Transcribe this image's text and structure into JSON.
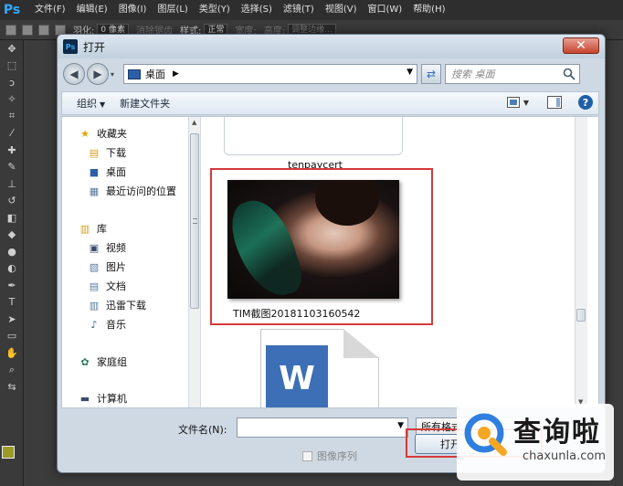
{
  "app": {
    "logo": "Ps",
    "menus": [
      "文件(F)",
      "编辑(E)",
      "图像(I)",
      "图层(L)",
      "类型(Y)",
      "选择(S)",
      "滤镜(T)",
      "视图(V)",
      "窗口(W)",
      "帮助(H)"
    ]
  },
  "options_bar": {
    "feather_label": "羽化:",
    "feather_value": "0 像素",
    "antialias_label": "消除锯齿",
    "style_label": "样式:",
    "style_value": "正常",
    "width_label": "宽度:",
    "height_label": "高度:",
    "refine_label": "调整边缘..."
  },
  "dialog": {
    "title": "打开",
    "close_symbol": "✕",
    "address": {
      "current": "桌面",
      "search_placeholder": "搜索 桌面"
    },
    "commands": {
      "organize": "组织",
      "new_folder": "新建文件夹"
    },
    "nav": {
      "favorites": "收藏夹",
      "downloads": "下载",
      "desktop": "桌面",
      "recent": "最近访问的位置",
      "libraries": "库",
      "videos": "视频",
      "pictures": "图片",
      "documents": "文档",
      "xunlei": "迅雷下载",
      "music": "音乐",
      "homegroup": "家庭组",
      "computer": "计算机"
    },
    "files": {
      "tenpay": "tenpaycert",
      "selected_image": "TIM截图20181103160542"
    },
    "bottom": {
      "filename_label": "文件名(N):",
      "filename_value": "",
      "filetype": "所有格式",
      "sequence_label": "图像序列",
      "open_button": "打开"
    }
  },
  "watermark": {
    "text": "查询啦",
    "url": "chaxunla.com"
  },
  "colors": {
    "highlight_border": "#d43a3a",
    "ps_accent": "#31a8ff",
    "foreground_swatch": "#9a9a25"
  }
}
